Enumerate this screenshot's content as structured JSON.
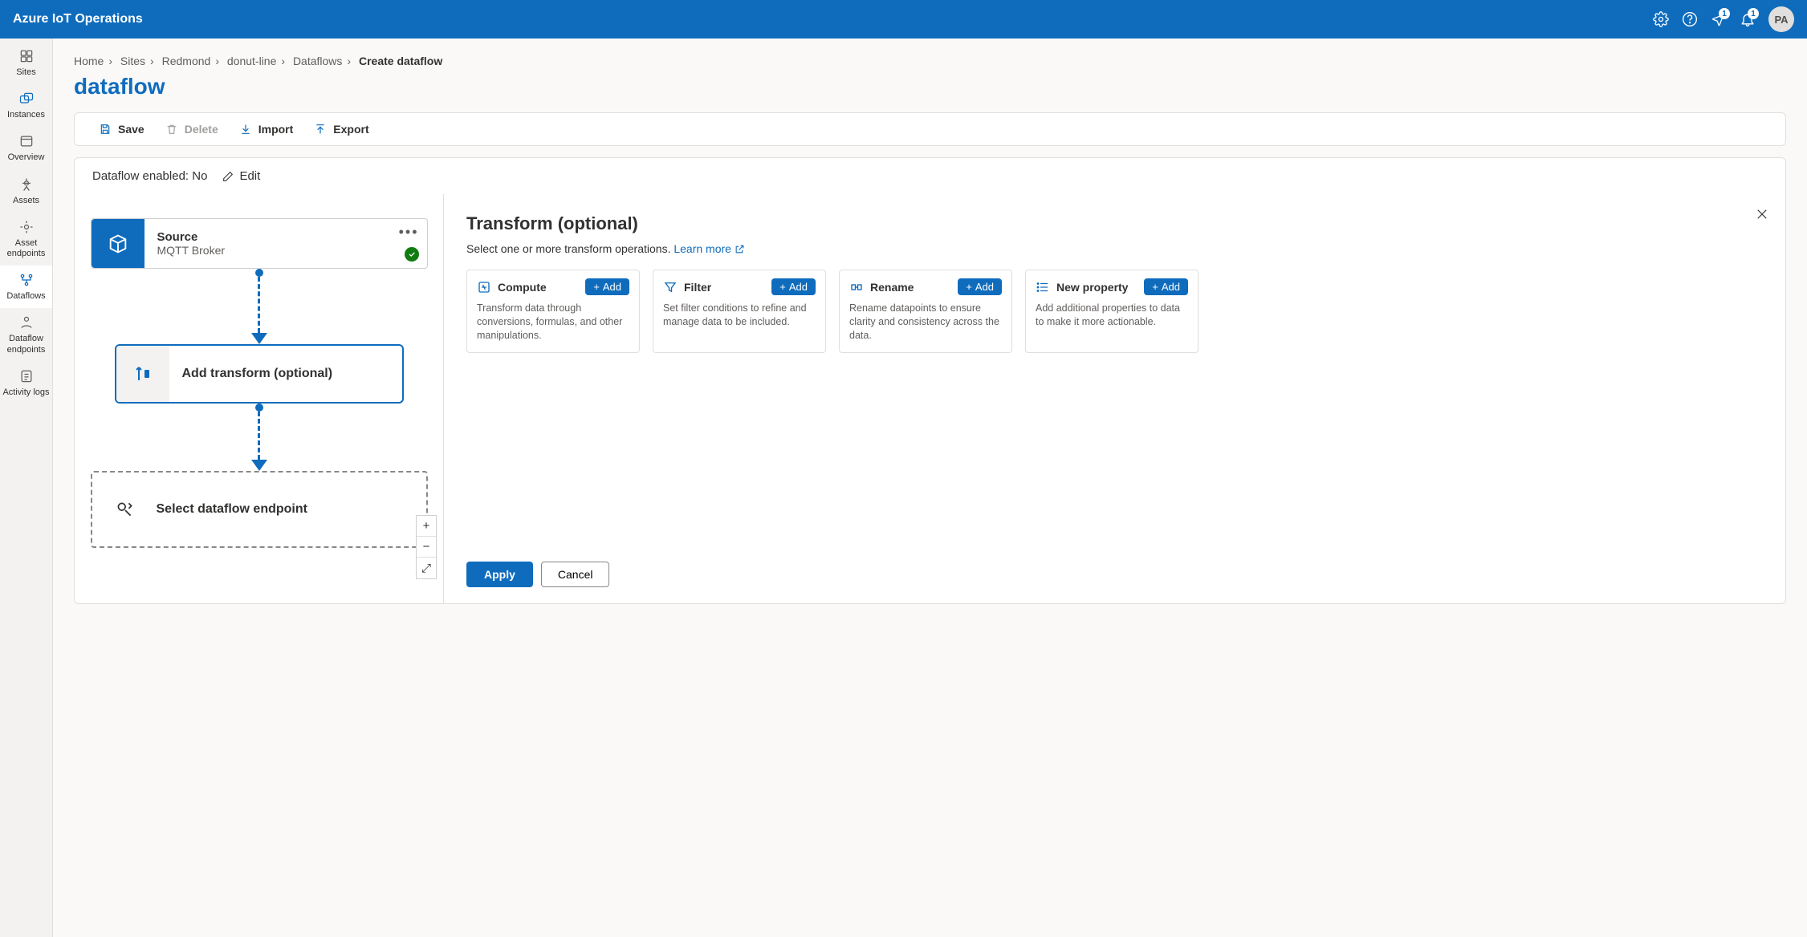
{
  "header": {
    "product": "Azure IoT Operations",
    "badge1": "1",
    "badge2": "1",
    "avatar": "PA"
  },
  "rail": {
    "items": [
      {
        "label": "Sites"
      },
      {
        "label": "Instances"
      },
      {
        "label": "Overview"
      },
      {
        "label": "Assets"
      },
      {
        "label": "Asset endpoints"
      },
      {
        "label": "Dataflows"
      },
      {
        "label": "Dataflow endpoints"
      },
      {
        "label": "Activity logs"
      }
    ]
  },
  "breadcrumb": {
    "items": [
      "Home",
      "Sites",
      "Redmond",
      "donut-line",
      "Dataflows"
    ],
    "current": "Create dataflow"
  },
  "page": {
    "title": "dataflow"
  },
  "toolbar": {
    "save": "Save",
    "delete": "Delete",
    "import": "Import",
    "export": "Export"
  },
  "dfHeader": {
    "label": "Dataflow enabled:",
    "value": "No",
    "edit": "Edit"
  },
  "nodes": {
    "source": {
      "title": "Source",
      "subtitle": "MQTT Broker"
    },
    "transform": {
      "title": "Add transform (optional)"
    },
    "dest": {
      "title": "Select dataflow endpoint"
    }
  },
  "detail": {
    "title": "Transform (optional)",
    "subtitle_text": "Select one or more transform operations. ",
    "learn_more": "Learn more",
    "apply": "Apply",
    "cancel": "Cancel",
    "add_label": "Add",
    "ops": [
      {
        "title": "Compute",
        "desc": "Transform data through conversions, formulas, and other manipulations."
      },
      {
        "title": "Filter",
        "desc": "Set filter conditions to refine and manage data to be included."
      },
      {
        "title": "Rename",
        "desc": "Rename datapoints to ensure clarity and consistency across the data."
      },
      {
        "title": "New property",
        "desc": "Add additional properties to data to make it more actionable."
      }
    ]
  }
}
